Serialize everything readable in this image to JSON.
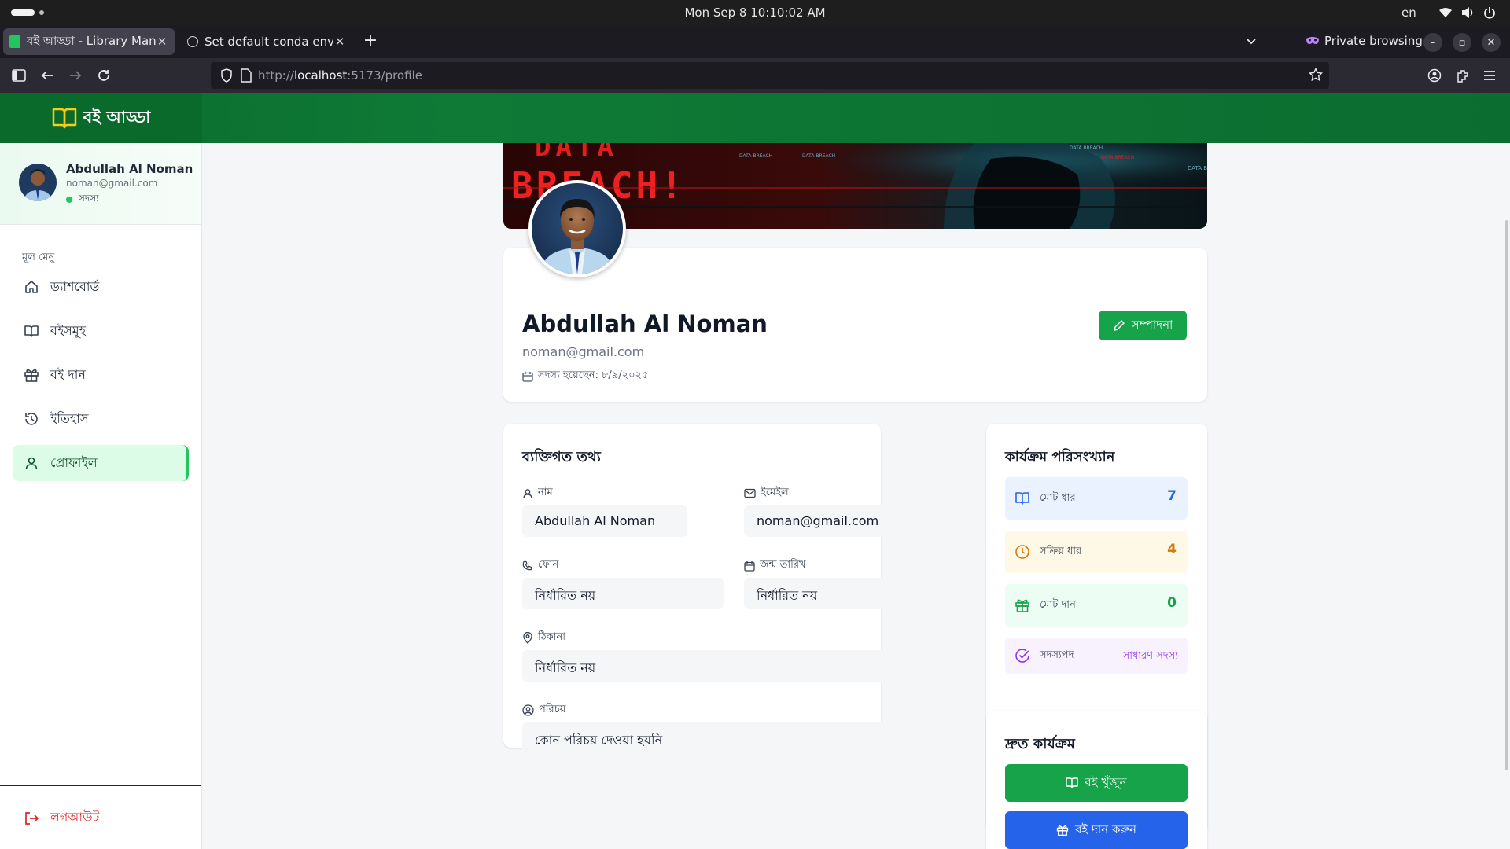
{
  "os": {
    "clock": "Mon Sep 8  10:10:02 AM",
    "lang": "en"
  },
  "browser": {
    "tabs": [
      {
        "title": "বই আড্ডা - Library Management",
        "active": true
      },
      {
        "title": "Set default conda env",
        "active": false
      }
    ],
    "private_label": "Private browsing",
    "url_prefix": "http://",
    "url_host": "localhost",
    "url_rest": ":5173/profile"
  },
  "app": {
    "brand": "বই আড্ডা",
    "colors": {
      "primary": "#16a34a",
      "header": "#0e7a36",
      "blue": "#2563eb",
      "amber": "#d97706",
      "purple": "#9333ea"
    }
  },
  "sidebar": {
    "user_name": "Abdullah Al Noman",
    "user_email": "noman@gmail.com",
    "user_role": "সদস্য",
    "menu_heading": "মূল মেনু",
    "items": [
      {
        "label": "ড্যাশবোর্ড",
        "icon": "home-icon"
      },
      {
        "label": "বইসমূহ",
        "icon": "book-icon"
      },
      {
        "label": "বই দান",
        "icon": "gift-icon"
      },
      {
        "label": "ইতিহাস",
        "icon": "history-icon"
      },
      {
        "label": "প্রোফাইল",
        "icon": "user-icon",
        "active": true
      }
    ],
    "logout": "লগআউট"
  },
  "cover": {
    "text_big": "DATA",
    "text_breach": "BREACH!",
    "small_labels": [
      "DATA BREACH",
      "DATA BREACH",
      "DATA BREACH",
      "DATA BREACH",
      "DATA B"
    ]
  },
  "profile": {
    "name": "Abdullah Al Noman",
    "email": "noman@gmail.com",
    "joined": "সদস্য হয়েছেন: ৮/৯/২০২৫",
    "edit_label": "সম্পাদনা"
  },
  "personal": {
    "title": "ব্যক্তিগত তথ্য",
    "name_label": "নাম",
    "name_value": "Abdullah Al Noman",
    "email_label": "ইমেইল",
    "email_value": "noman@gmail.com",
    "phone_label": "ফোন",
    "phone_value": "নির্ধারিত নয়",
    "dob_label": "জন্ম তারিখ",
    "dob_value": "নির্ধারিত নয়",
    "address_label": "ঠিকানা",
    "address_value": "নির্ধারিত নয়",
    "bio_label": "পরিচয়",
    "bio_value": "কোন পরিচয় দেওয়া হয়নি"
  },
  "stats": {
    "title": "কার্যক্রম পরিসংখ্যান",
    "total_borrow_label": "মোট ধার",
    "total_borrow": "7",
    "active_borrow_label": "সক্রিয় ধার",
    "active_borrow": "4",
    "total_donation_label": "মোট দান",
    "total_donation": "0",
    "membership_label": "সদস্যপদ",
    "membership_value": "সাধারণ সদস্য"
  },
  "quick": {
    "title": "দ্রুত কার্যক্রম",
    "find_books": "বই খুঁজুন",
    "donate_book": "বই দান করুন"
  }
}
